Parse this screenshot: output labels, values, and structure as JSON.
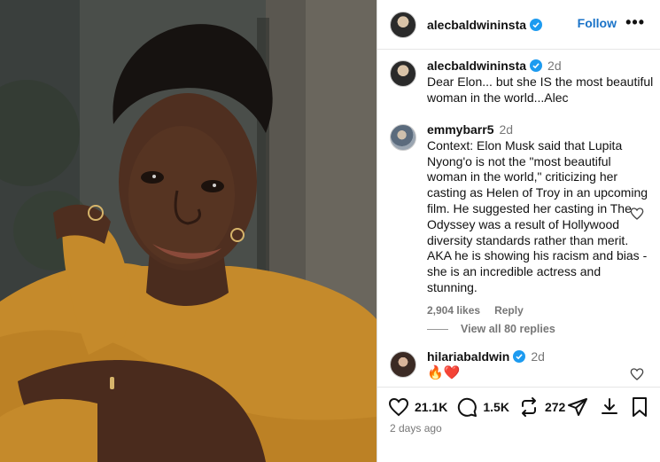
{
  "post": {
    "username": "alecbaldwininsta",
    "follow_label": "Follow",
    "more_label": "•••",
    "icons": {
      "verified": "verified-badge-icon",
      "more": "more-options-icon"
    },
    "colors": {
      "accent": "#1a73c8",
      "verified": "#1d9bf0",
      "like": "#ed4956"
    }
  },
  "caption": {
    "username": "alecbaldwininsta",
    "time": "2d",
    "text": "Dear Elon... but she IS the most beautiful woman in the world...Alec"
  },
  "comments": [
    {
      "username": "emmybarr5",
      "time": "2d",
      "text": "Context: Elon Musk said that Lupita Nyong'o is not the \"most beautiful woman in the world,\" criticizing her casting as Helen of Troy in an upcoming film. He suggested her casting in The Odyssey was a result of Hollywood diversity standards rather than merit. AKA he is showing his racism and bias - she is an incredible actress and stunning.",
      "likes": "2,904 likes",
      "reply_label": "Reply",
      "view_replies": "View all 80 replies"
    },
    {
      "username": "hilariabaldwin",
      "time": "2d",
      "text": "🔥❤️"
    }
  ],
  "actions": {
    "likes": "21.1K",
    "comments": "1.5K",
    "reposts": "272",
    "icons": [
      "heart-icon",
      "comment-icon",
      "repost-icon",
      "share-icon",
      "download-icon",
      "bookmark-icon"
    ]
  },
  "timestamp": "2 days ago"
}
